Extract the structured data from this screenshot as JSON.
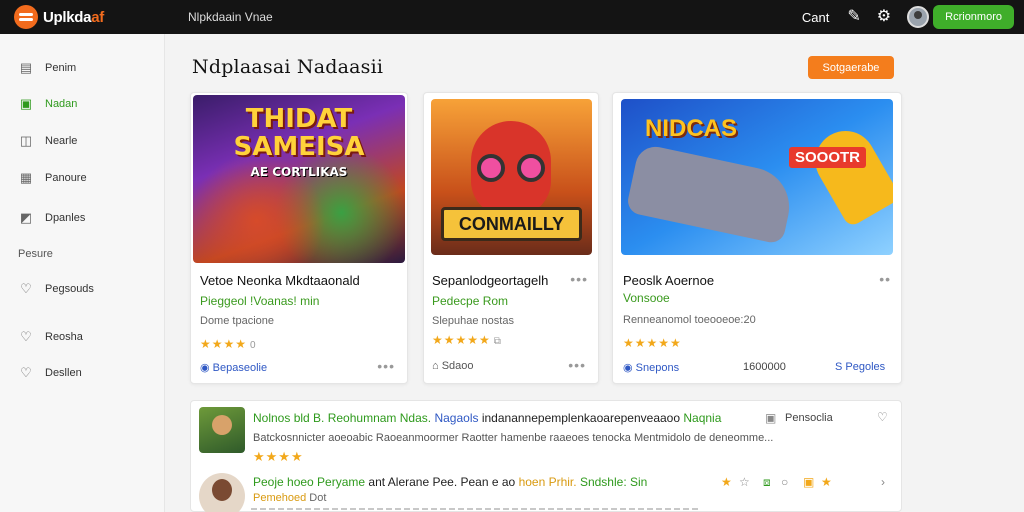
{
  "header": {
    "logo_main": "Uplkda",
    "logo_accent": "af",
    "app_title": "Nlpkdaain Vnae",
    "cart_label": "Cant",
    "account_label": "Rcrionmoro"
  },
  "sidebar": {
    "items": [
      {
        "label": "Penim",
        "icon": "page-icon"
      },
      {
        "label": "Nadan",
        "icon": "home-icon",
        "active": true
      },
      {
        "label": "Nearle",
        "icon": "tag-icon"
      },
      {
        "label": "Panoure",
        "icon": "calendar-icon"
      },
      {
        "label": "Dpanles",
        "icon": "send-icon"
      }
    ],
    "section_label": "Pesure",
    "section_items": [
      {
        "label": "Pegsouds",
        "icon": "heart-icon"
      },
      {
        "label": "Reosha",
        "icon": "heart-icon"
      },
      {
        "label": "Desllen",
        "icon": "heart-icon"
      }
    ]
  },
  "main": {
    "title": "Ndplaasai  Nadaasii",
    "primary_button": "Sotgaerabe"
  },
  "cards": [
    {
      "art_title": "THIDAT SAMEISA",
      "art_subtitle": "AE CORTLIKAS",
      "title": "Vetoe Neonka Mkdtaaonald",
      "subtitle": "Pieggeol !Voanas! min",
      "meta": "Dome tpacione",
      "stars": "★★★★",
      "rating_extra": "0",
      "link": "Bepaseolie"
    },
    {
      "art_title": "CONMAILLY",
      "title": "Sepanlodgeortagelh",
      "subtitle": "Pedecpe Rom",
      "meta": "Slepuhae nostas",
      "stars": "★★★★★",
      "rating_extra": "⧉",
      "link": "Sdaoo",
      "link_prefix": "⌂ "
    },
    {
      "art_title": "NIDCAS",
      "art_tag": "SOOOTR",
      "title": "Peoslk Aoernoe",
      "subtitle": "Vonsooe",
      "meta": "Renneanomol toeooeoe:20",
      "stars": "★★★★★",
      "link": "Snepons",
      "extra_count": "1600000",
      "extra_link": "S Pegoles"
    }
  ],
  "feed": [
    {
      "author": "Nolnos bld",
      "mid": "B. Reohumnam",
      "tag": "Ndas.",
      "handle": "Nagaols",
      "rest": "indanannepemplenkaoarepenveaaoo",
      "rest_tail": "Naqnia",
      "body": "Batckosnnicter aoeoabic Raoeanmoormer Raotter hamenbe raaeoes tenocka Mentmidolo de deneomme...",
      "stars": "★★★★",
      "label": "Pensoclia"
    },
    {
      "author": "Peoje hoeo Peryame",
      "rest": "ant Alerane Pee. Pean e ao",
      "mid": "hoen Prhir.",
      "tail": "Sndshle: Sin",
      "sub_a": "Pemehoed",
      "sub_b": "Dot"
    }
  ]
}
